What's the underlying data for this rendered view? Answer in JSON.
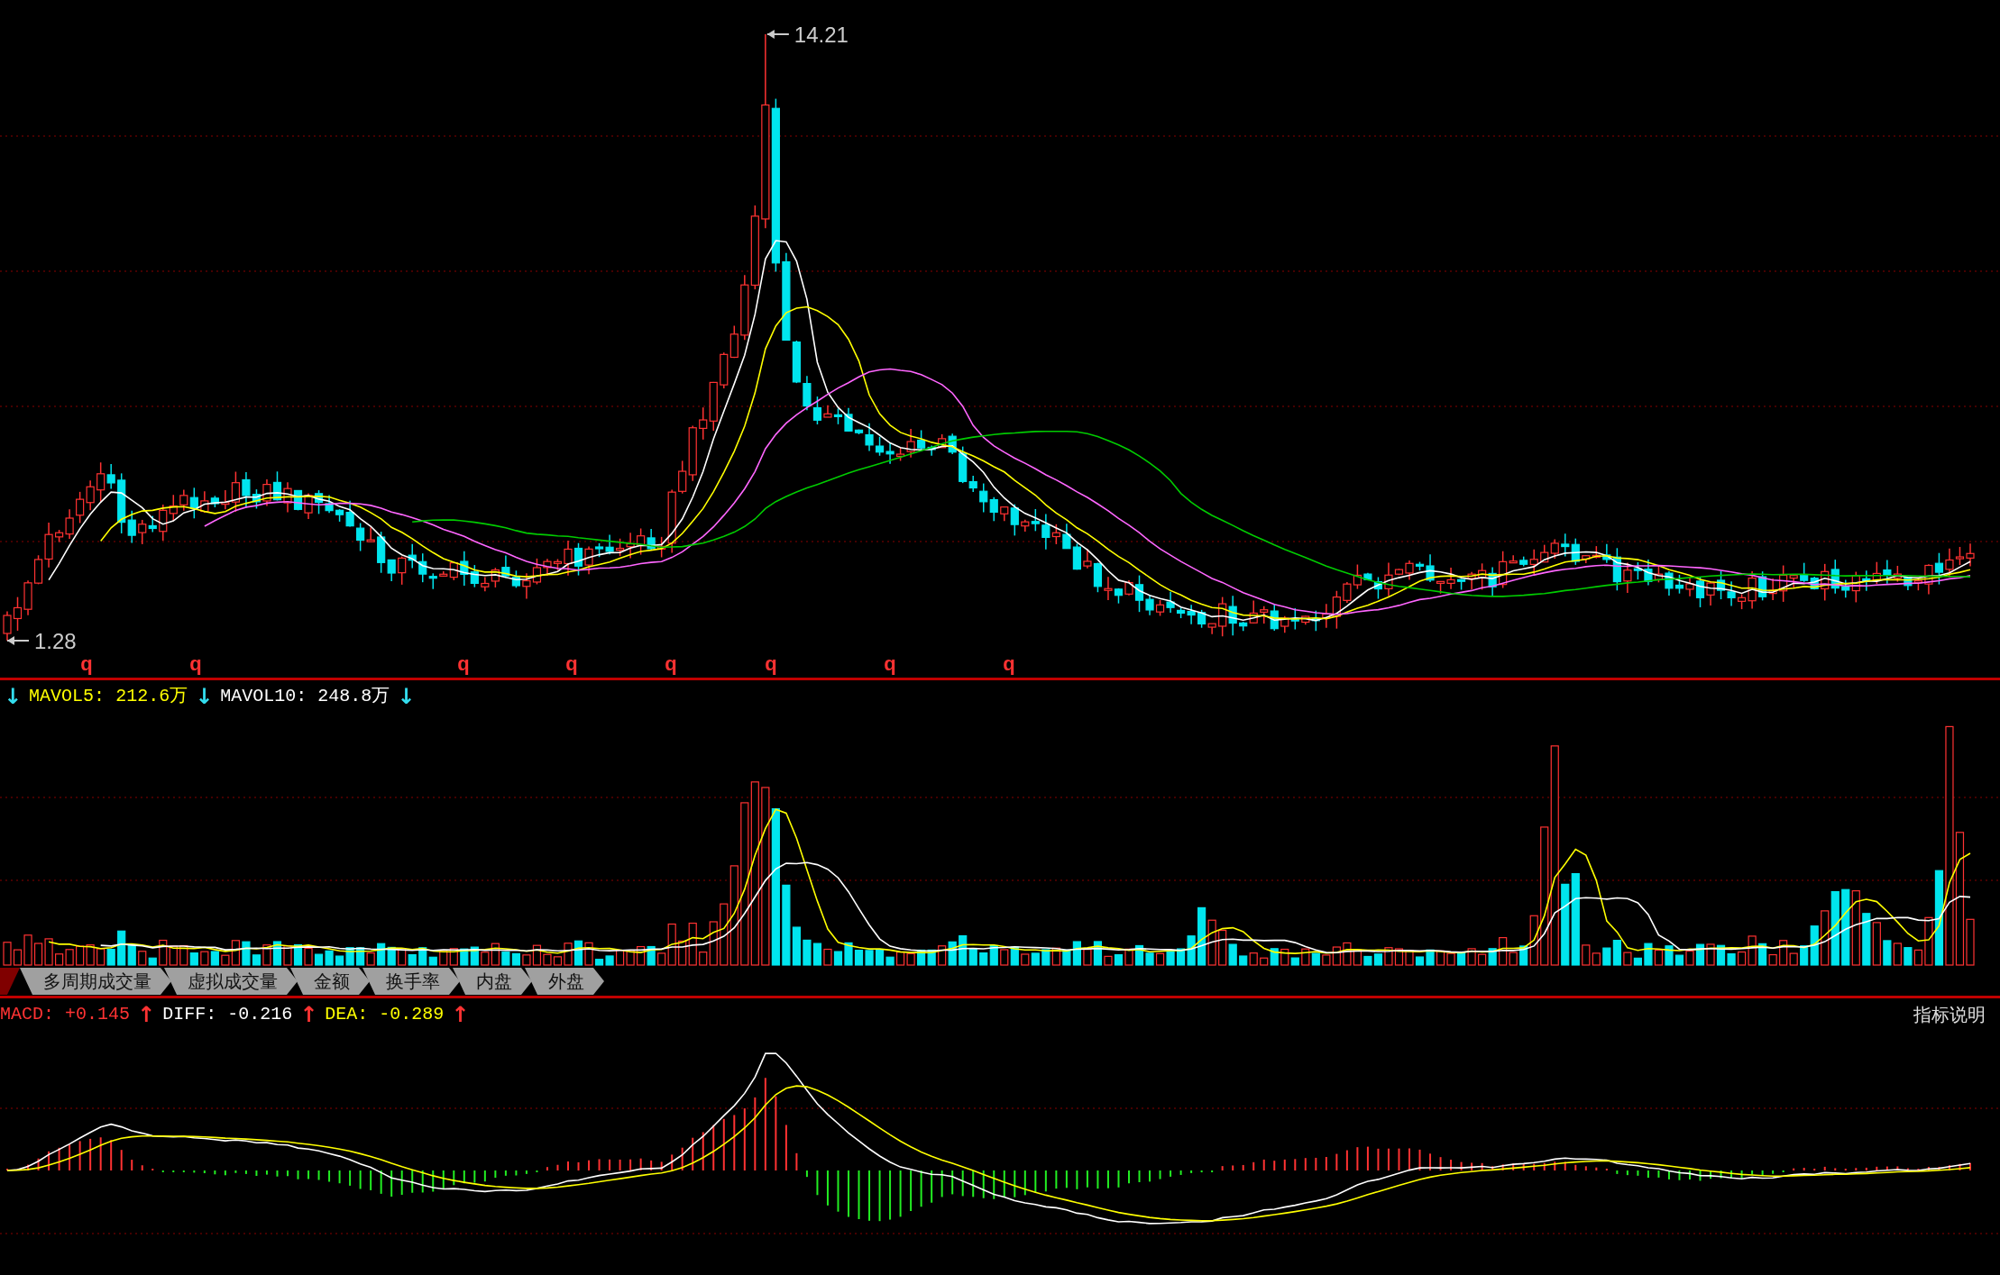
{
  "price_chart": {
    "high_label": "14.21",
    "low_label": "1.28",
    "signal_markers": [
      {
        "text": "q"
      },
      {
        "text": "q"
      },
      {
        "text": "q"
      },
      {
        "text": "q"
      },
      {
        "text": "q"
      },
      {
        "text": "q"
      },
      {
        "text": "q"
      },
      {
        "text": "q"
      }
    ]
  },
  "volume_legend": [
    {
      "text": "↓",
      "color": "#33ddee"
    },
    {
      "text": "MAVOL5: 212.6万",
      "color": "#ffff00"
    },
    {
      "text": "↓",
      "color": "#33ddee"
    },
    {
      "text": "MAVOL10: 248.8万",
      "color": "#ffffff"
    },
    {
      "text": "↓",
      "color": "#33ddee"
    }
  ],
  "indicator_tabs": [
    {
      "label": "多周期成交量",
      "selected": false
    },
    {
      "label": "虚拟成交量",
      "selected": false
    },
    {
      "label": "金额",
      "selected": false
    },
    {
      "label": "换手率",
      "selected": false
    },
    {
      "label": "内盘",
      "selected": false
    },
    {
      "label": "外盘",
      "selected": false
    }
  ],
  "macd_legend": [
    {
      "text": "MACD: +0.145",
      "color": "#ff3333"
    },
    {
      "text": "↑",
      "color": "#ff3333"
    },
    {
      "text": "DIFF: -0.216",
      "color": "#ffffff"
    },
    {
      "text": "↑",
      "color": "#ff3333"
    },
    {
      "text": "DEA: -0.289",
      "color": "#ffff00"
    },
    {
      "text": "↑",
      "color": "#ff3333"
    }
  ],
  "indicator_help_link": "指标说明"
}
